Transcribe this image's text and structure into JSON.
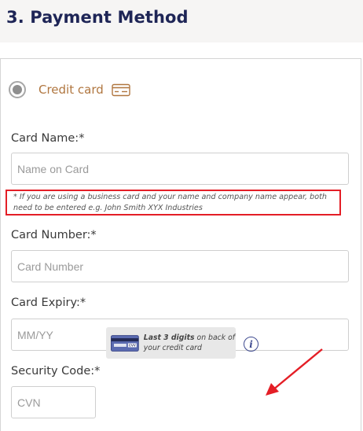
{
  "section": {
    "title": "3. Payment Method"
  },
  "method": {
    "label": "Credit card",
    "icon": "credit-card-icon",
    "selected": true
  },
  "fields": {
    "card_name": {
      "label": "Card Name:*",
      "placeholder": "Name on Card"
    },
    "card_number": {
      "label": "Card Number:*",
      "placeholder": "Card Number"
    },
    "card_expiry": {
      "label": "Card Expiry:*",
      "placeholder": "MM/YY"
    },
    "security_code": {
      "label": "Security Code:*",
      "placeholder": "CVN"
    }
  },
  "notice": {
    "text": "* If you are using a business card and your name and company name appear, both need to be entered e.g. John Smith XYX Industries"
  },
  "cvv_hint": {
    "bold": "Last 3 digits",
    "rest": " on back of your credit card",
    "card_badge": "CVV"
  },
  "info": {
    "glyph": "i",
    "icon": "info-icon"
  },
  "annotations": {
    "highlight_color": "#e41e26",
    "arrow_color": "#e41e26"
  },
  "colors": {
    "title": "#1e2556",
    "method_label": "#b0763f",
    "info": "#3e4a8f"
  }
}
